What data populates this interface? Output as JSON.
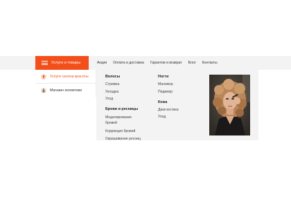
{
  "header": {
    "catalog_label": "Услуги и товары",
    "nav": [
      "Акции",
      "Оплата и доставка",
      "Гарантии и возврат",
      "Блог",
      "Контакты"
    ]
  },
  "sidebar": {
    "items": [
      {
        "label": "Услуги салона красоты",
        "active": true
      },
      {
        "label": "Магазин косметики",
        "active": false
      }
    ]
  },
  "dropdown": {
    "col1": {
      "group1": {
        "title": "Волосы",
        "links": [
          "Стрижка",
          "Укладка",
          "Уход"
        ]
      },
      "group2": {
        "title": "Брови и ресницы",
        "links": [
          "Моделирование бровей",
          "Коррекция бровей",
          "Окрашивание ресниц"
        ]
      }
    },
    "col2": {
      "group1": {
        "title": "Ногти",
        "links": [
          "Маникюр",
          "Педикюр"
        ]
      },
      "group2": {
        "title": "Кожа",
        "links": [
          "Диагностика",
          "Уход"
        ]
      }
    }
  },
  "colors": {
    "accent": "#f34f1b",
    "panel_bg": "#f3f3f3"
  }
}
